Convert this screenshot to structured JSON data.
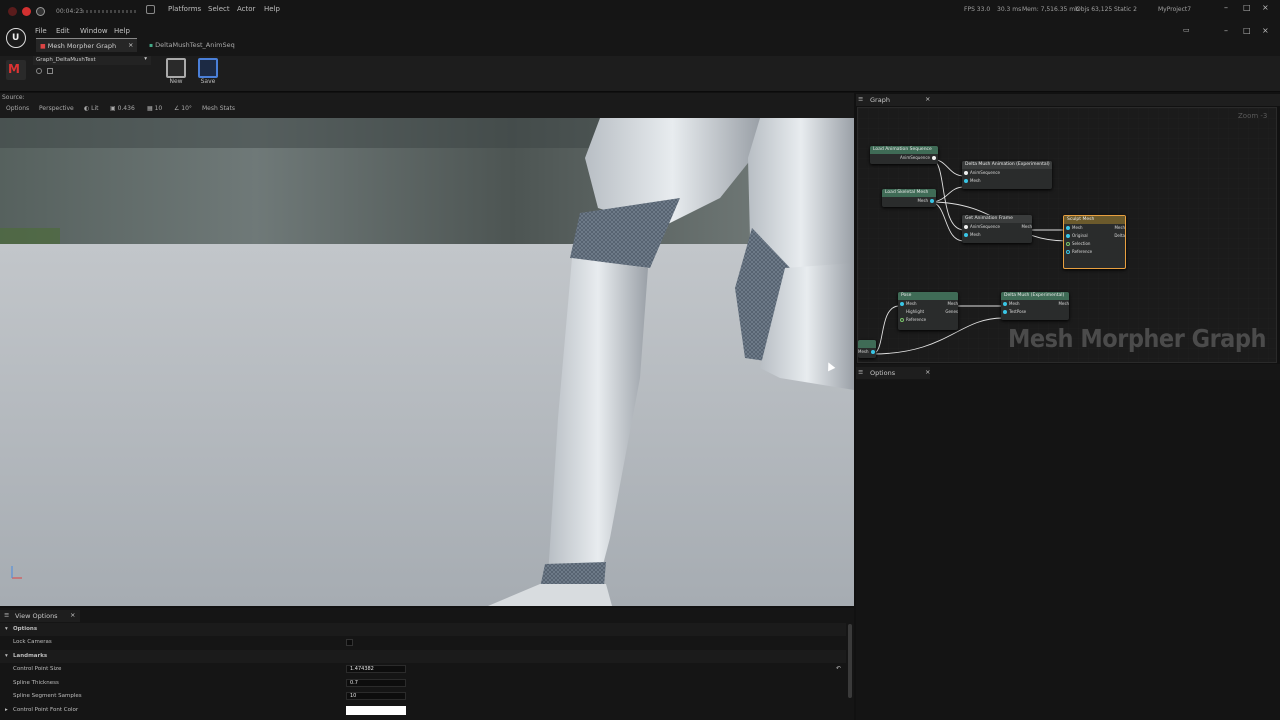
{
  "system_bar": {
    "timer": "00:04:23",
    "menu": [
      "Platforms",
      "Select",
      "Actor",
      "Help"
    ],
    "stats": {
      "fps": "FPS 33.0",
      "ms": "30.3 ms",
      "mem": "Mem: 7,516.35 mb",
      "objs": "Objs 63,125",
      "static": "Static 2"
    },
    "project": "MyProject7"
  },
  "app_menu": [
    "File",
    "Edit",
    "Window",
    "Help"
  ],
  "tabs": [
    {
      "label": "Mesh Morpher Graph",
      "active": true,
      "close": "×"
    },
    {
      "label": "DeltaMushTest_AnimSeq",
      "active": false
    }
  ],
  "toolbar": {
    "asset_dropdown": "Graph_DeltaMushTest",
    "buttons": [
      {
        "label": "New"
      },
      {
        "label": "Save"
      }
    ]
  },
  "viewport": {
    "source_label": "Source:",
    "chips": [
      "Options",
      "Perspective",
      "Lit",
      "0.436",
      "10",
      "10°",
      "Mesh Stats"
    ]
  },
  "graph_panel": {
    "title": "Graph",
    "zoom": "Zoom -3",
    "watermark": "Mesh Morpher Graph",
    "nodes": {
      "load_anim": {
        "title": "Load Animation Sequence",
        "out": "AnimSequence"
      },
      "load_skel": {
        "title": "Load Skeletal Mesh",
        "out": "Mesh"
      },
      "delta_anim": {
        "title": "Delta Mush Animation (Experimental)",
        "in": [
          "AnimSequence",
          "Mesh"
        ]
      },
      "get_frame": {
        "title": "Get Animation Frame",
        "in": [
          "AnimSequence",
          "Mesh"
        ],
        "out": "Mesh"
      },
      "sculpt": {
        "title": "Sculpt Mesh",
        "in": [
          "Mesh",
          "Original",
          "Selection",
          "Reference"
        ],
        "out": [
          "Mesh",
          "Delta"
        ]
      },
      "pose": {
        "title": "Pose",
        "in": [
          "Mesh",
          "Highlight",
          "Reference"
        ],
        "out": [
          "Mesh",
          "Genes"
        ]
      },
      "delta_mush": {
        "title": "Delta Mush (Experimental)",
        "in": [
          "Mesh",
          "TestPose"
        ],
        "out": "Mesh"
      },
      "edge": {
        "out": "Mesh"
      }
    }
  },
  "options_panel": {
    "title": "Options"
  },
  "view_options": {
    "tab": "View Options",
    "sections": [
      {
        "label": "Options",
        "rows": [
          {
            "label": "Lock Cameras",
            "type": "checkbox"
          }
        ]
      },
      {
        "label": "Landmarks",
        "rows": [
          {
            "label": "Control Point Size",
            "value": "1.474382"
          },
          {
            "label": "Spline Thickness",
            "value": "0.7"
          },
          {
            "label": "Spline Segment Samples",
            "value": "10"
          },
          {
            "label": "Control Point Font Color",
            "type": "color"
          }
        ]
      }
    ]
  },
  "colors": {
    "accent": "#3ac6e6",
    "selected_node": "#e8a040",
    "node_green": "#3f6b56"
  }
}
